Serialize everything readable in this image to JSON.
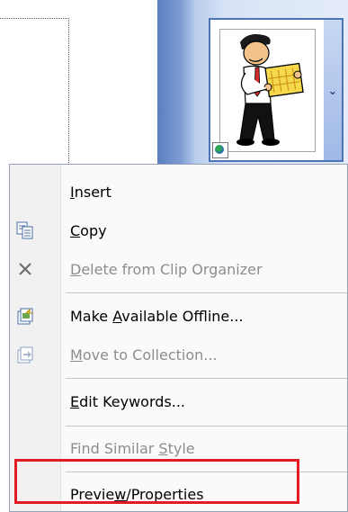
{
  "menu": {
    "items": [
      {
        "prefix": "",
        "accel": "I",
        "suffix": "nsert",
        "icon": "none",
        "enabled": true
      },
      {
        "prefix": "",
        "accel": "C",
        "suffix": "opy",
        "icon": "copy-icon",
        "enabled": true
      },
      {
        "prefix": "",
        "accel": "D",
        "suffix": "elete from Clip Organizer",
        "icon": "delete-x-icon",
        "enabled": false
      },
      {
        "prefix": "Make ",
        "accel": "A",
        "suffix": "vailable Offline...",
        "icon": "offline-icon",
        "enabled": true
      },
      {
        "prefix": "",
        "accel": "M",
        "suffix": "ove to Collection...",
        "icon": "move-to-collection-icon",
        "enabled": false
      },
      {
        "prefix": "",
        "accel": "E",
        "suffix": "dit Keywords...",
        "icon": "none",
        "enabled": true
      },
      {
        "prefix": "Find Similar ",
        "accel": "S",
        "suffix": "tyle",
        "icon": "none",
        "enabled": false
      },
      {
        "prefix": "Previe",
        "accel": "w",
        "suffix": "/Properties",
        "icon": "none",
        "enabled": true
      }
    ]
  },
  "colors": {
    "highlight": "#e31b23",
    "pane_blue": "#7c9bd3",
    "disabled_text": "#8d8d8d"
  }
}
